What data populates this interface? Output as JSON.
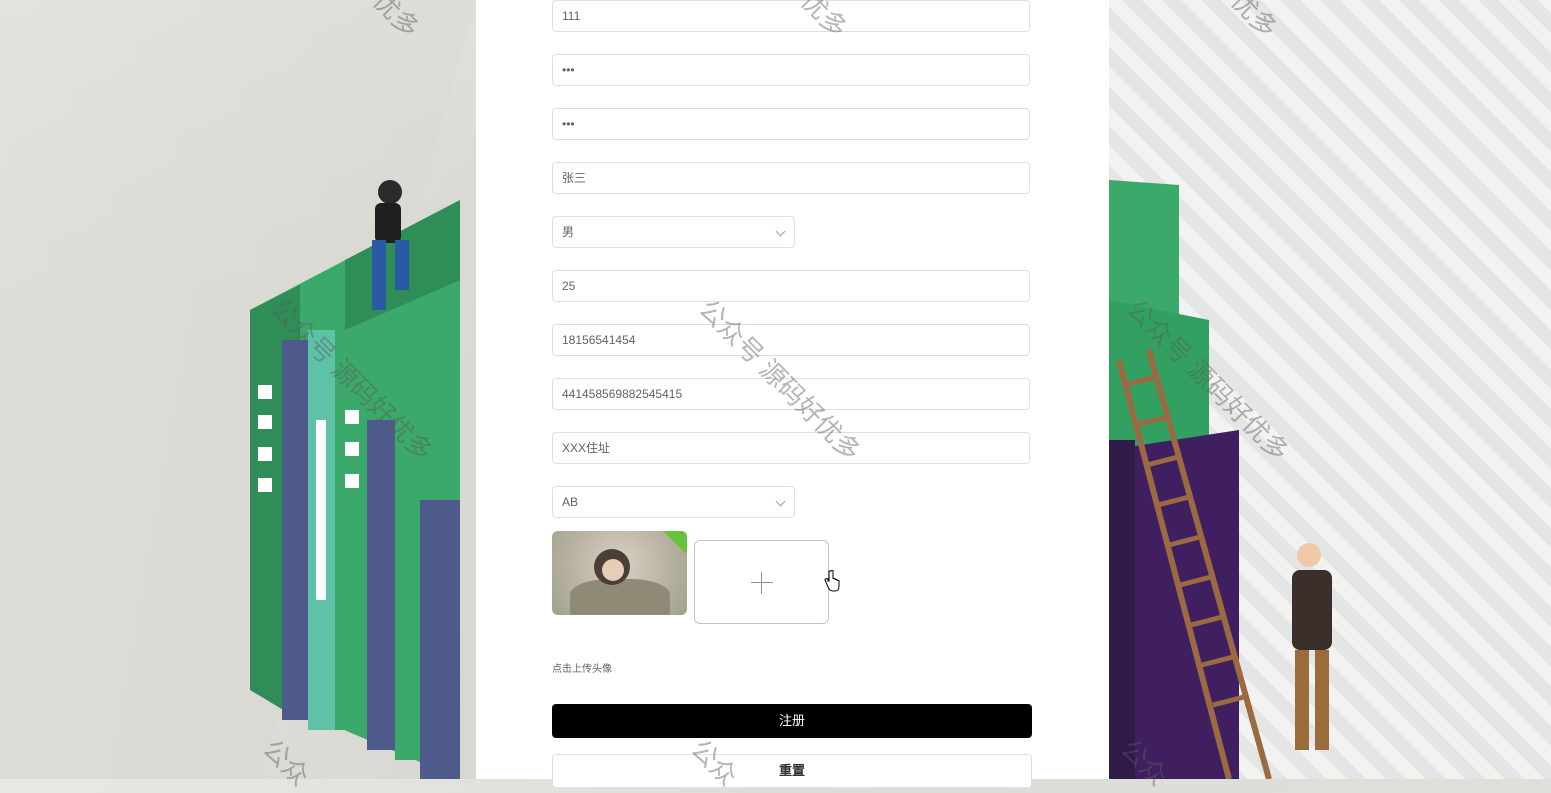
{
  "form": {
    "username_value": "111",
    "password_value": "•••",
    "confirm_password_value": "•••",
    "name_value": "张三",
    "gender_value": "男",
    "age_value": "25",
    "phone_value": "18156541454",
    "id_card_value": "441458569882545415",
    "address_value": "XXX住址",
    "blood_type_value": "AB",
    "avatar_hint": "点击上传头像",
    "register_label": "注册",
    "reset_label": "重置"
  },
  "watermark": {
    "text_full": "公众号 源码好优多",
    "text_partial_top": "优多",
    "text_partial_bottom": "公众"
  },
  "colors": {
    "primary_button": "#000000",
    "upload_badge": "#67c23a",
    "book_green": "#3fae6a",
    "book_purple": "#4b3e7a"
  },
  "icons": {
    "select_arrow": "chevron-down-icon",
    "upload": "plus-icon",
    "cursor": "hand-pointer-icon",
    "upload_success": "check-badge-icon"
  }
}
